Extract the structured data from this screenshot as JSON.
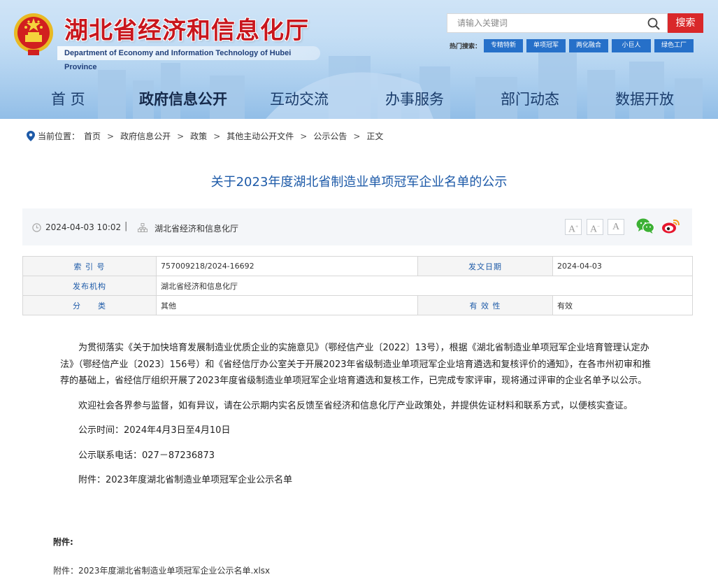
{
  "header": {
    "site_title": "湖北省经济和信息化厅",
    "site_subtitle": "Department of Economy and Information Technology of Hubei Province",
    "search_placeholder": "请输入关键词",
    "search_button": "搜索",
    "hot_label": "热门搜索：",
    "hot_tags": [
      "专精特新",
      "单项冠军",
      "两化融合",
      "小巨人",
      "绿色工厂"
    ]
  },
  "nav": {
    "items": [
      "首  页",
      "政府信息公开",
      "互动交流",
      "办事服务",
      "部门动态",
      "数据开放"
    ],
    "active_index": 1
  },
  "breadcrumb": {
    "label": "当前位置：",
    "items": [
      "首页",
      "政府信息公开",
      "政策",
      "其他主动公开文件",
      "公示公告",
      "正文"
    ],
    "separator": ">"
  },
  "article": {
    "title": "关于2023年度湖北省制造业单项冠军企业名单的公示",
    "date": "2024-04-03 10:02",
    "divider": "|",
    "org": "湖北省经济和信息化厅",
    "font_buttons": [
      "A",
      "A",
      "A"
    ]
  },
  "info_table": {
    "index_label": "索 引 号",
    "index_value": "757009218/2024-16692",
    "issue_date_label": "发文日期",
    "issue_date_value": "2024-04-03",
    "publisher_label": "发布机构",
    "publisher_value": "湖北省经济和信息化厅",
    "category_label": "分　　类",
    "category_value": "其他",
    "validity_label": "有 效 性",
    "validity_value": "有效"
  },
  "body": {
    "p1": "为贯彻落实《关于加快培育发展制造业优质企业的实施意见》（鄂经信产业〔2022〕13号），根据《湖北省制造业单项冠军企业培育管理认定办法》（鄂经信产业〔2023〕156号）和《省经信厅办公室关于开展2023年省级制造业单项冠军企业培育遴选和复核评价的通知》，在各市州初审和推荐的基础上，省经信厅组织开展了2023年度省级制造业单项冠军企业培育遴选和复核工作，已完成专家评审，现将通过评审的企业名单予以公示。",
    "p2": "欢迎社会各界参与监督，如有异议，请在公示期内实名反馈至省经济和信息化厅产业政策处，并提供佐证材料和联系方式，以便核实查证。",
    "p3": "公示时间：2024年4月3日至4月10日",
    "p4": "公示联系电话：027－87236873",
    "p5": "附件：2023年度湖北省制造业单项冠军企业公示名单",
    "attach_heading": "附件:",
    "attach_link": "附件：2023年度湖北省制造业单项冠军企业公示名单.xlsx"
  },
  "colors": {
    "title_red": "#c8161d",
    "link_blue": "#1d5aa8",
    "search_red": "#d9282a",
    "tag_blue": "#2670c9"
  }
}
